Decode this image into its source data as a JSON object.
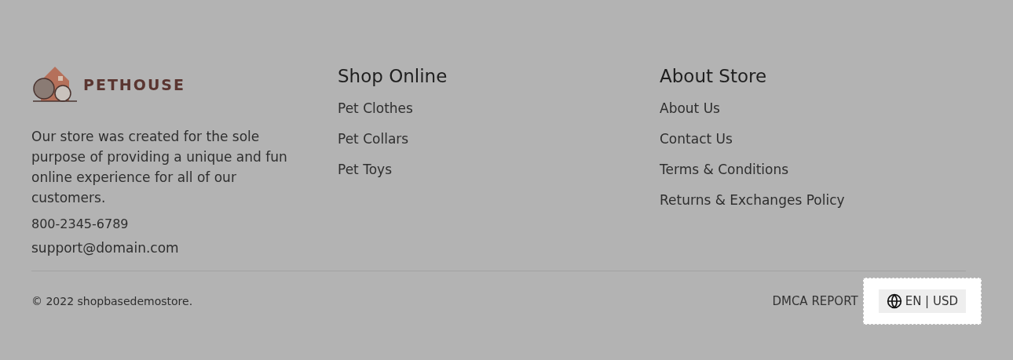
{
  "brand": {
    "name": "PETHOUSE"
  },
  "about": {
    "text": "Our store was created for the sole purpose of providing a unique and fun online experience for all of our customers.",
    "phone": "800-2345-6789",
    "email": "support@domain.com"
  },
  "columns": [
    {
      "title": "Shop Online",
      "links": [
        "Pet Clothes",
        "Pet Collars",
        "Pet Toys"
      ]
    },
    {
      "title": "About Store",
      "links": [
        "About Us",
        "Contact Us",
        "Terms & Conditions",
        "Returns & Exchanges Policy"
      ]
    }
  ],
  "copyright": "© 2022 shopbasedemostore.",
  "dmca": "DMCA REPORT",
  "locale": {
    "label": "EN | USD"
  }
}
